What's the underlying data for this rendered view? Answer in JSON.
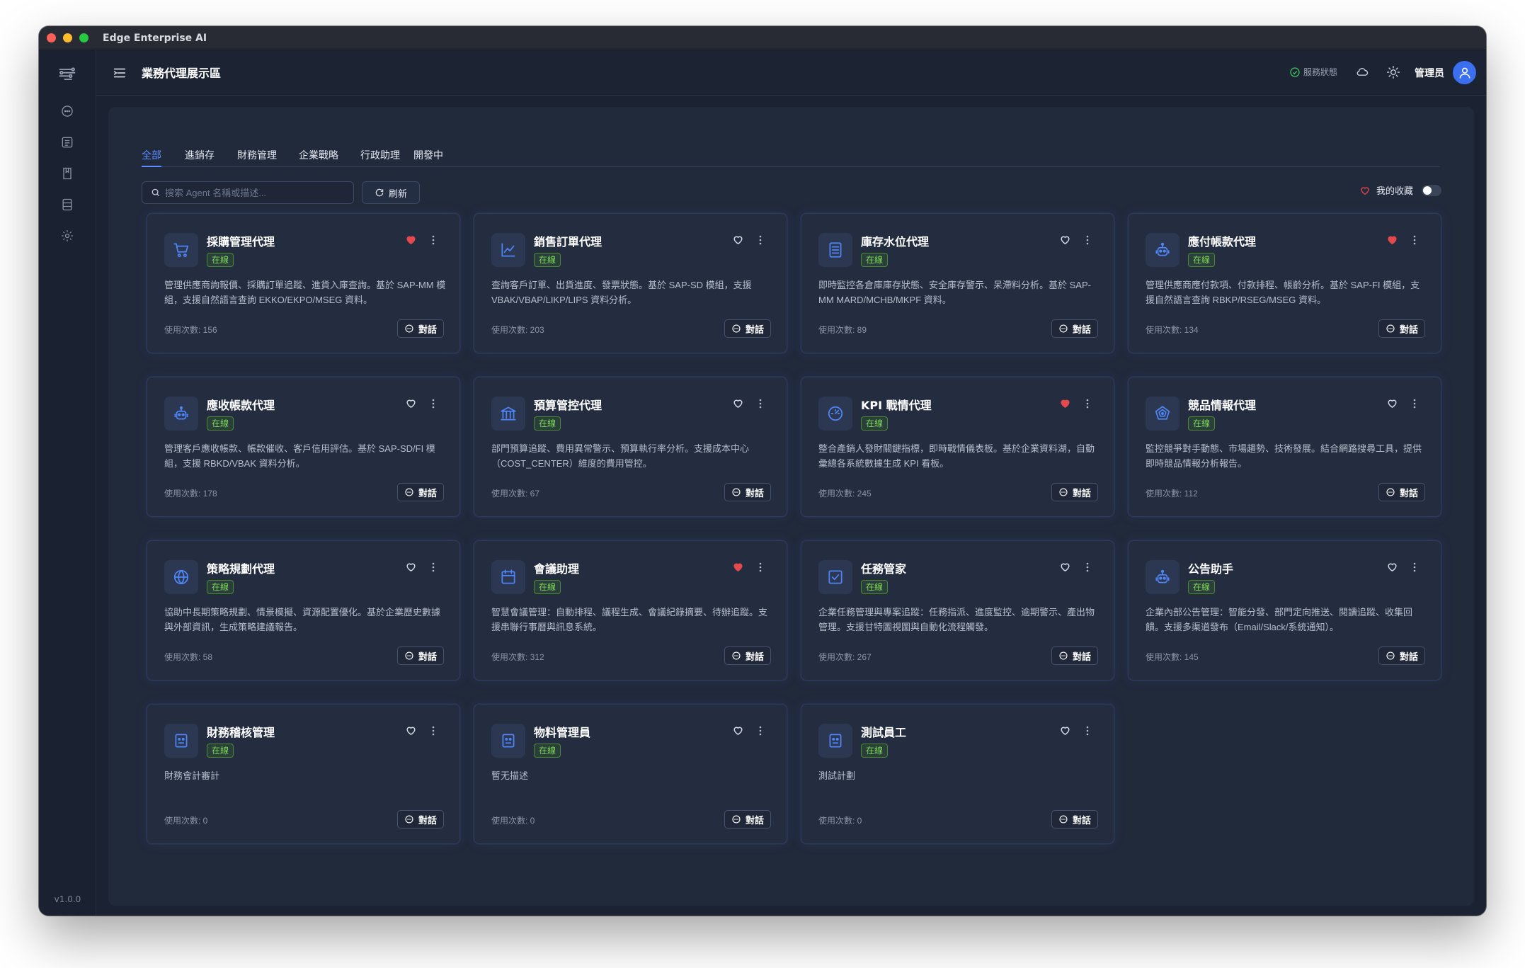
{
  "app": {
    "title": "Edge Enterprise AI",
    "version": "v1.0.0"
  },
  "topbar": {
    "page_title": "業務代理展示區",
    "service_status": "服務狀態",
    "admin_name": "管理员"
  },
  "tabs": [
    {
      "label": "全部",
      "active": true
    },
    {
      "label": "進銷存",
      "active": false
    },
    {
      "label": "財務管理",
      "active": false
    },
    {
      "label": "企業戰略",
      "active": false
    },
    {
      "label": "行政助理",
      "active": false
    },
    {
      "label": "開發中",
      "active": false
    }
  ],
  "toolbar": {
    "search_placeholder": "搜索 Agent 名稱或描述...",
    "refresh_label": "刷新",
    "favorites_label": "我的收藏",
    "favorites_only": false
  },
  "card_labels": {
    "status": "在線",
    "usage_prefix": "使用次數: ",
    "chat": "對話"
  },
  "colors": {
    "accent": "#5f8dff",
    "status_green": "#7ed957",
    "favorite_red": "#e5484d",
    "background": "#1b2232"
  },
  "agents": [
    {
      "name": "採購管理代理",
      "icon": "cart-icon",
      "favorite": true,
      "description": "管理供應商詢報價、採購訂單追蹤、進貨入庫查詢。基於 SAP-MM 模組，支援自然語言查詢 EKKO/EKPO/MSEG 資料。",
      "usage": "156"
    },
    {
      "name": "銷售訂單代理",
      "icon": "line-chart-icon",
      "favorite": false,
      "description": "查詢客戶訂單、出貨進度、發票狀態。基於 SAP-SD 模組，支援 VBAK/VBAP/LIKP/LIPS 資料分析。",
      "usage": "203"
    },
    {
      "name": "庫存水位代理",
      "icon": "document-icon",
      "favorite": false,
      "description": "即時監控各倉庫庫存狀態、安全庫存警示、呆滯料分析。基於 SAP-MM MARD/MCHB/MKPF 資料。",
      "usage": "89"
    },
    {
      "name": "應付帳款代理",
      "icon": "robot-icon",
      "favorite": true,
      "description": "管理供應商應付款項、付款排程、帳齡分析。基於 SAP-FI 模組，支援自然語言查詢 RBKP/RSEG/MSEG 資料。",
      "usage": "134"
    },
    {
      "name": "應收帳款代理",
      "icon": "robot-icon",
      "favorite": false,
      "description": "管理客戶應收帳款、帳款催收、客戶信用評估。基於 SAP-SD/FI 模組，支援 RBKD/VBAK 資料分析。",
      "usage": "178"
    },
    {
      "name": "預算管控代理",
      "icon": "bank-icon",
      "favorite": false,
      "description": "部門預算追蹤、費用異常警示、預算執行率分析。支援成本中心（COST_CENTER）維度的費用管控。",
      "usage": "67"
    },
    {
      "name": "KPI 戰情代理",
      "icon": "dashboard-icon",
      "favorite": true,
      "description": "整合產銷人發財關鍵指標，即時戰情儀表板。基於企業資料湖，自動彙總各系統數據生成 KPI 看板。",
      "usage": "245"
    },
    {
      "name": "競品情報代理",
      "icon": "radar-icon",
      "favorite": false,
      "description": "監控競爭對手動態、市場趨勢、技術發展。結合網路搜尋工具，提供即時競品情報分析報告。",
      "usage": "112"
    },
    {
      "name": "策略規劃代理",
      "icon": "globe-icon",
      "favorite": false,
      "description": "協助中長期策略規劃、情景模擬、資源配置優化。基於企業歷史數據與外部資訊，生成策略建議報告。",
      "usage": "58"
    },
    {
      "name": "會議助理",
      "icon": "calendar-icon",
      "favorite": true,
      "description": "智慧會議管理：自動排程、議程生成、會議紀錄摘要、待辦追蹤。支援串聯行事曆與訊息系統。",
      "usage": "312"
    },
    {
      "name": "任務管家",
      "icon": "checkbox-icon",
      "favorite": false,
      "description": "企業任務管理與專案追蹤：任務指派、進度監控、逾期警示、產出物管理。支援甘特圖視圖與自動化流程觸發。",
      "usage": "267"
    },
    {
      "name": "公告助手",
      "icon": "robot-icon",
      "favorite": false,
      "description": "企業內部公告管理：智能分發、部門定向推送、閱讀追蹤、收集回饋。支援多渠道發布（Email/Slack/系統通知）。",
      "usage": "145"
    },
    {
      "name": "財務稽核管理",
      "icon": "bot-face-icon",
      "favorite": false,
      "description": "財務會計審計",
      "usage": "0"
    },
    {
      "name": "物料管理員",
      "icon": "bot-face-icon",
      "favorite": false,
      "description": "暫无描述",
      "usage": "0"
    },
    {
      "name": "測試員工",
      "icon": "bot-face-icon",
      "favorite": false,
      "description": "測試計劃",
      "usage": "0"
    }
  ]
}
